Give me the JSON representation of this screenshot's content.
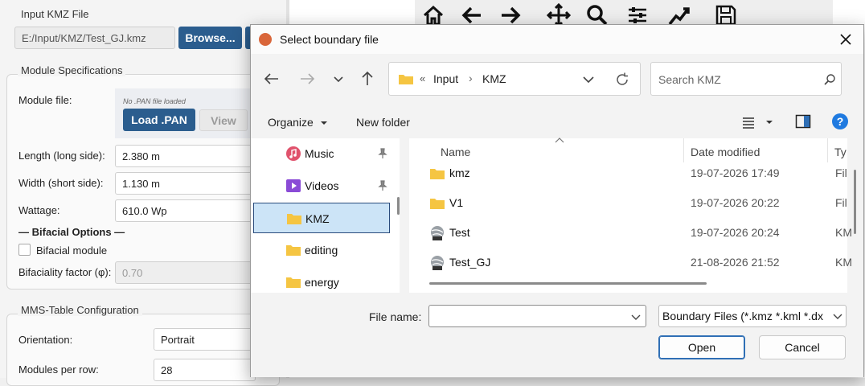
{
  "app": {
    "kmz_group": "Input KMZ File",
    "kmz_path": "E:/Input/KMZ/Test_GJ.kmz",
    "browse_label": "Browse...",
    "module_group": "Module Specifications",
    "module_file_label": "Module file:",
    "no_pan_text": "No .PAN file loaded",
    "load_pan_label": "Load .PAN",
    "view_label": "View",
    "length_label": "Length (long side):",
    "length_value": "2.380  m",
    "width_label": "Width (short side):",
    "width_value": "1.130  m",
    "wattage_label": "Wattage:",
    "wattage_value": "610.0  Wp",
    "bifacial_header": "— Bifacial Options —",
    "bifacial_checkbox": "Bifacial module",
    "bifaciality_label": "Bifaciality factor (φ):",
    "bifaciality_value": "0.70",
    "mms_group": "MMS-Table Configuration",
    "orientation_label": "Orientation:",
    "orientation_value": "Portrait",
    "modules_row_label": "Modules per row:",
    "modules_row_value": "28"
  },
  "dialog": {
    "title": "Select boundary file",
    "breadcrumb": {
      "overflow": "«",
      "parts": [
        "Input",
        "KMZ"
      ]
    },
    "search_placeholder": "Search KMZ",
    "organize_label": "Organize",
    "new_folder_label": "New folder",
    "nav_items": [
      {
        "label": "Music",
        "icon": "music-icon",
        "pinned": true
      },
      {
        "label": "Videos",
        "icon": "video-icon",
        "pinned": true
      },
      {
        "label": "KMZ",
        "icon": "folder-icon",
        "selected": true
      },
      {
        "label": "editing",
        "icon": "folder-icon"
      },
      {
        "label": "energy",
        "icon": "folder-icon"
      }
    ],
    "columns": {
      "name": "Name",
      "date": "Date modified",
      "type": "Ty"
    },
    "files": [
      {
        "name": "kmz",
        "date": "19-07-2026 17:49",
        "type": "Fil",
        "icon": "folder-icon"
      },
      {
        "name": "V1",
        "date": "19-07-2026 20:22",
        "type": "Fil",
        "icon": "folder-icon"
      },
      {
        "name": "Test",
        "date": "19-07-2026 20:24",
        "type": "KM",
        "icon": "kmz-file-icon"
      },
      {
        "name": "Test_GJ",
        "date": "21-08-2026 21:52",
        "type": "KM",
        "icon": "kmz-file-icon"
      }
    ],
    "file_name_label": "File name:",
    "file_name_value": "",
    "file_type_value": "Boundary Files (*.kmz *.kml *.dx",
    "open_label": "Open",
    "cancel_label": "Cancel"
  },
  "colors": {
    "accent": "#2b5d8e",
    "selection": "#cce4f7",
    "folder": "#f5c542",
    "title_dot": "#d9663a"
  }
}
